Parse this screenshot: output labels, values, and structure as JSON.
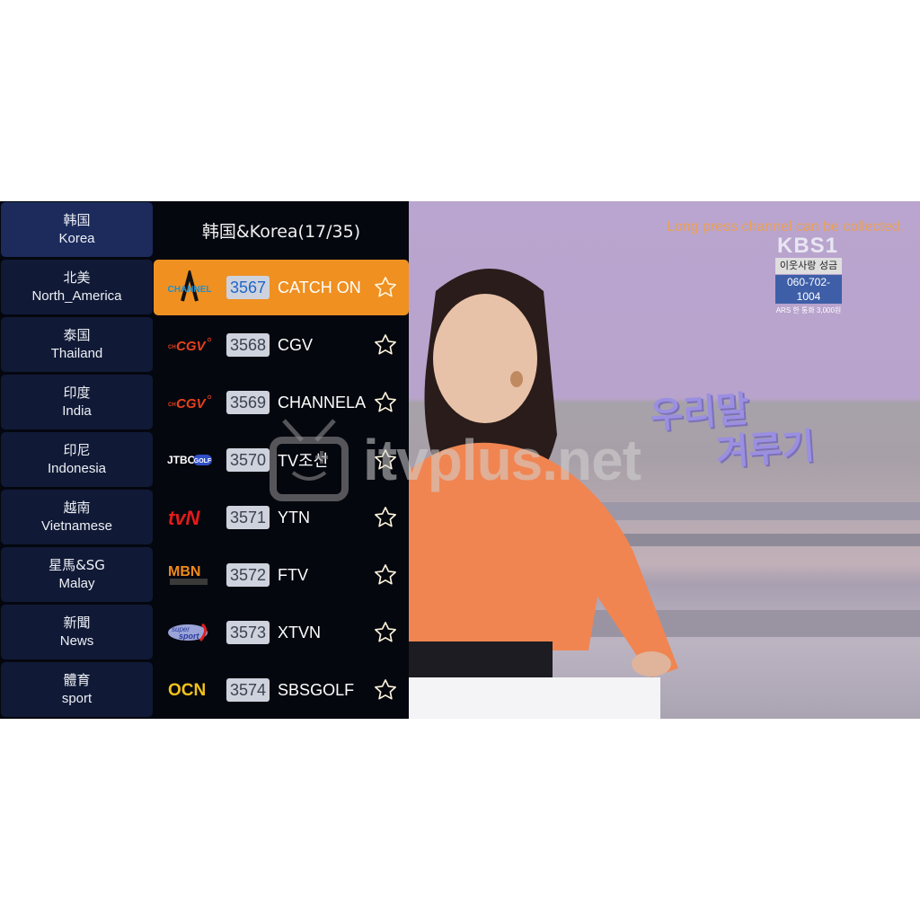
{
  "categories": [
    {
      "cn": "韩国",
      "en": "Korea",
      "active": true
    },
    {
      "cn": "北美",
      "en": "North_America"
    },
    {
      "cn": "泰国",
      "en": "Thailand"
    },
    {
      "cn": "印度",
      "en": "India"
    },
    {
      "cn": "印尼",
      "en": "Indonesia"
    },
    {
      "cn": "越南",
      "en": "Vietnamese"
    },
    {
      "cn": "星馬&SG",
      "en": "Malay"
    },
    {
      "cn": "新聞",
      "en": "News"
    },
    {
      "cn": "體育",
      "en": "sport"
    }
  ],
  "channel_list": {
    "title": "韩国&Korea(17/35)",
    "channels": [
      {
        "number": "3567",
        "name": "CATCH ON",
        "logo": "channel-a-logo",
        "logo_text": "CHANNEL",
        "active": true
      },
      {
        "number": "3568",
        "name": "CGV",
        "logo": "cgv-logo",
        "logo_text": "CGV"
      },
      {
        "number": "3569",
        "name": "CHANNELA",
        "logo": "cgv-logo",
        "logo_text": "CGV"
      },
      {
        "number": "3570",
        "name": "TV조선",
        "logo": "jtbc-golf-logo",
        "logo_text": "JTBC GOLF"
      },
      {
        "number": "3571",
        "name": "YTN",
        "logo": "tvn-logo",
        "logo_text": "tvN"
      },
      {
        "number": "3572",
        "name": "FTV",
        "logo": "mbn-logo",
        "logo_text": "MBN"
      },
      {
        "number": "3573",
        "name": "XTVN",
        "logo": "supersport-logo",
        "logo_text": "SuperSport"
      },
      {
        "number": "3574",
        "name": "SBSGOLF",
        "logo": "ocn-logo",
        "logo_text": "OCN"
      }
    ]
  },
  "video": {
    "hint": "Long press channel can be collected.",
    "broadcaster": "KBS1",
    "donation_label": "이웃사랑 성금",
    "phone": "060-702-1004",
    "phone_sub": "ARS 한 통화 3,000원",
    "show_title_line1": "우리말",
    "show_title_line2": "겨루기"
  },
  "watermark": {
    "text": "itvplus.net"
  },
  "colors": {
    "accent": "#ef9021",
    "sidebar_active": "#1c2b5c",
    "sidebar_item": "#101a36",
    "background": "#05070f"
  }
}
